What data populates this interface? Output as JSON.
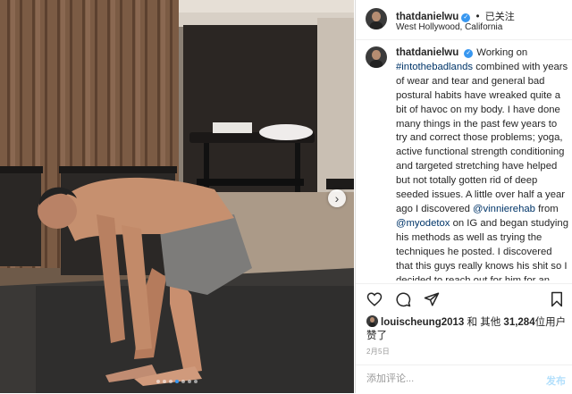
{
  "header": {
    "username": "thatdanielwu",
    "follow_label": "已关注",
    "location": "West Hollywood, California"
  },
  "caption": {
    "username": "thatdanielwu",
    "segments": [
      {
        "text": "Working on ",
        "link": false
      },
      {
        "text": "#intothebadlands",
        "link": true
      },
      {
        "text": " combined with years of wear and tear and general bad postural habits have wreaked quite a bit of havoc on my body. I have done many things in the past few years to try and correct those problems; yoga, active functional strength conditioning and targeted stretching have helped but not totally gotten rid of deep seeded issues. A little over half a year ago I discovered ",
        "link": false
      },
      {
        "text": "@vinnierehab",
        "link": true
      },
      {
        "text": " from ",
        "link": false
      },
      {
        "text": "@myodetox",
        "link": true
      },
      {
        "text": " on IG and began studying his methods as well as trying the techniques he posted. I discovered that this guys really knows his shit so I decided to reach out for him for an assessment and treatment. The past four days he worked intensively with",
        "link": false
      }
    ]
  },
  "actions": {
    "like_icon": "heart-icon",
    "comment_icon": "comment-icon",
    "share_icon": "paper-plane-icon",
    "save_icon": "bookmark-icon"
  },
  "likes": {
    "user": "louischeung2013",
    "and_others": "和 其他",
    "count": "31,284",
    "suffix": "位用户",
    "line2": "赞了"
  },
  "date": "2月5日",
  "comment": {
    "placeholder": "添加评论...",
    "post_label": "发布"
  },
  "media": {
    "carousel_total": 7,
    "carousel_active": 3
  },
  "colors": {
    "link": "#003569",
    "verified": "#3897f0",
    "post_button": "#b2dffc"
  }
}
